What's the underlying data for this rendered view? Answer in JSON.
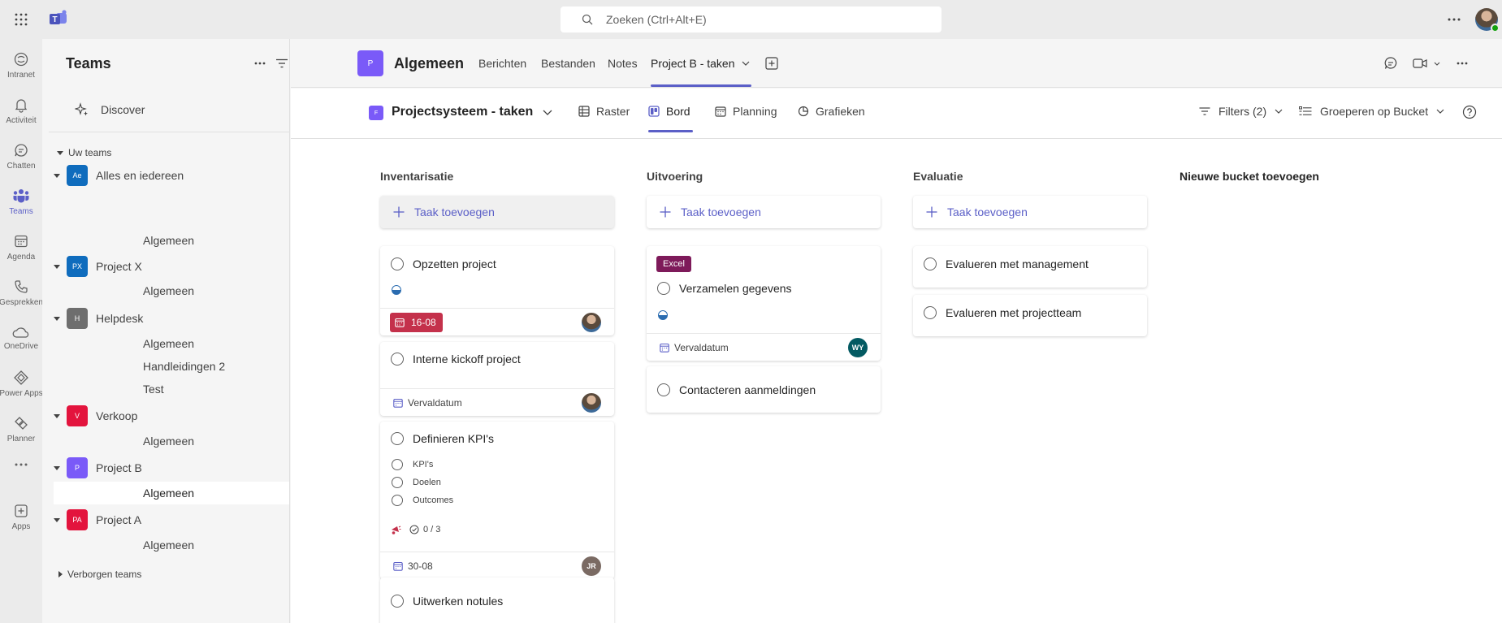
{
  "search": {
    "placeholder": "Zoeken (Ctrl+Alt+E)"
  },
  "rail": [
    {
      "label": "Intranet",
      "icon": "intranet-icon"
    },
    {
      "label": "Activiteit",
      "icon": "bell-icon"
    },
    {
      "label": "Chatten",
      "icon": "chat-icon"
    },
    {
      "label": "Teams",
      "icon": "teams-icon"
    },
    {
      "label": "Agenda",
      "icon": "calendar-icon"
    },
    {
      "label": "Gesprekken",
      "icon": "phone-icon"
    },
    {
      "label": "OneDrive",
      "icon": "cloud-icon"
    },
    {
      "label": "Power Apps",
      "icon": "power-apps-icon"
    },
    {
      "label": "Planner",
      "icon": "planner-icon"
    },
    {
      "label": "",
      "icon": "more-icon"
    },
    {
      "label": "Apps",
      "icon": "apps-add-icon"
    }
  ],
  "leftpanel": {
    "title": "Teams",
    "discover": "Discover",
    "section_label": "Uw teams",
    "teams": [
      {
        "initials": "Ae",
        "name": "Alles en iedereen",
        "color": "#0f6cbd",
        "channels": [
          "Algemeen"
        ]
      },
      {
        "initials": "PX",
        "name": "Project X",
        "color": "#0f6cbd",
        "channels": [
          "Algemeen"
        ]
      },
      {
        "initials": "H",
        "name": "Helpdesk",
        "color": "#6e6e6e",
        "channels": [
          "Algemeen",
          "Handleidingen 2",
          "Test"
        ]
      },
      {
        "initials": "V",
        "name": "Verkoop",
        "color": "#e3143d",
        "channels": [
          "Algemeen"
        ]
      },
      {
        "initials": "P",
        "name": "Project B",
        "color": "#7a5af8",
        "channels": [
          "Algemeen"
        ]
      },
      {
        "initials": "PA",
        "name": "Project A",
        "color": "#e3143d",
        "channels": [
          "Algemeen"
        ]
      }
    ],
    "hidden_teams": "Verborgen teams"
  },
  "channel": {
    "avatar": "P",
    "title": "Algemeen",
    "tabs": [
      "Berichten",
      "Bestanden",
      "Notes",
      "Project B - taken"
    ]
  },
  "planner": {
    "plan_avatar": "F",
    "plan_name": "Projectsysteem - taken",
    "views": [
      "Raster",
      "Bord",
      "Planning",
      "Grafieken"
    ],
    "filters": "Filters (2)",
    "group_by": "Groeperen op Bucket"
  },
  "board": {
    "add_task": "Taak toevoegen",
    "new_bucket": "Nieuwe bucket toevoegen",
    "buckets": [
      {
        "title": "Inventarisatie",
        "cards": [
          {
            "title": "Opzetten project",
            "progress": "in-progress",
            "due": "16-08",
            "late": true
          },
          {
            "title": "Interne kickoff project",
            "due": "Vervaldatum"
          },
          {
            "title": "Definieren KPI's",
            "checklist": [
              "KPI's",
              "Doelen",
              "Outcomes"
            ],
            "checklist_count": "0 / 3",
            "due": "30-08",
            "assignee": "JR"
          },
          {
            "title": "Uitwerken notules"
          }
        ]
      },
      {
        "title": "Uitvoering",
        "cards": [
          {
            "label": "Excel",
            "label_color": "#7e1a5a",
            "title": "Verzamelen gegevens",
            "progress": "in-progress",
            "due": "Vervaldatum",
            "assignee": "WY"
          },
          {
            "title": "Contacteren aanmeldingen"
          }
        ]
      },
      {
        "title": "Evaluatie",
        "cards": [
          {
            "title": "Evalueren met management"
          },
          {
            "title": "Evalueren met projectteam"
          }
        ]
      }
    ]
  },
  "colors": {
    "accent": "#5b5fc7",
    "late": "#c4314b",
    "jr_avatar": "#7a6a63",
    "wy_avatar": "#035a62"
  }
}
